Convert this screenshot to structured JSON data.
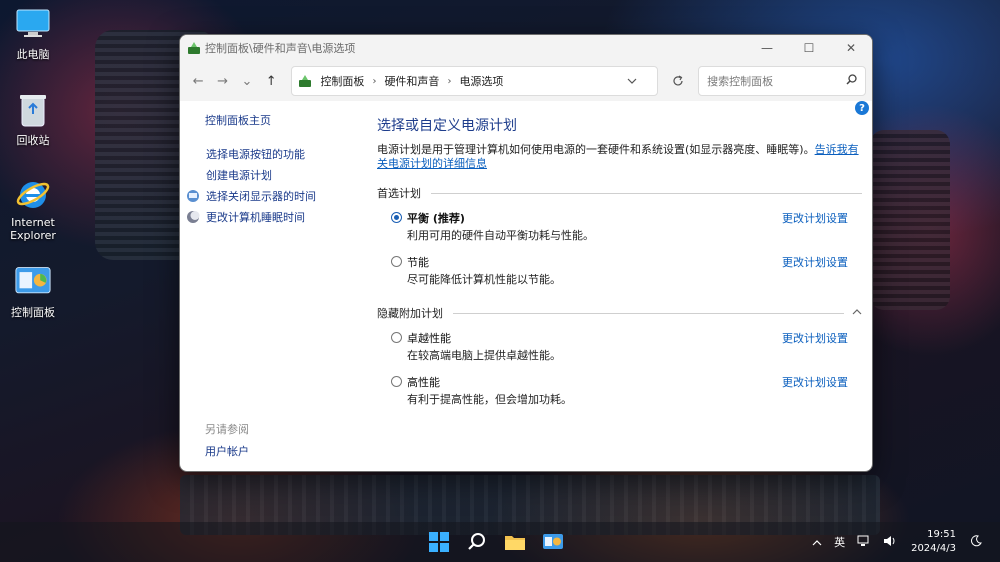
{
  "desktop": {
    "icons": [
      {
        "label": "此电脑"
      },
      {
        "label": "回收站"
      },
      {
        "label": "Internet Explorer"
      },
      {
        "label": "控制面板"
      }
    ]
  },
  "window": {
    "title": "控制面板\\硬件和声音\\电源选项",
    "controls": {
      "minimize": "—",
      "maximize": "☐",
      "close": "✕"
    },
    "nav": {
      "back": "←",
      "forward": "→",
      "recent": "⌄",
      "up": "↑"
    },
    "breadcrumb": [
      "控制面板",
      "硬件和声音",
      "电源选项"
    ],
    "breadcrumb_sep": "›",
    "search_placeholder": "搜索控制面板",
    "help": "?"
  },
  "left_pane": {
    "home": "控制面板主页",
    "links": [
      {
        "label": "选择电源按钮的功能",
        "icon": "none"
      },
      {
        "label": "创建电源计划",
        "icon": "none"
      },
      {
        "label": "选择关闭显示器的时间",
        "icon": "monitor-icon"
      },
      {
        "label": "更改计算机睡眠时间",
        "icon": "moon-icon"
      }
    ],
    "see_also": "另请参阅",
    "user_accounts": "用户帐户"
  },
  "main": {
    "heading": "选择或自定义电源计划",
    "description": "电源计划是用于管理计算机如何使用电源的一套硬件和系统设置(如显示器亮度、睡眠等)。",
    "description_link": "告诉我有关电源计划的详细信息",
    "preferred_group": "首选计划",
    "hidden_group": "隐藏附加计划",
    "change_label": "更改计划设置",
    "preferred_plans": [
      {
        "name": "平衡 (推荐)",
        "desc": "利用可用的硬件自动平衡功耗与性能。",
        "selected": true
      },
      {
        "name": "节能",
        "desc": "尽可能降低计算机性能以节能。",
        "selected": false
      }
    ],
    "hidden_plans": [
      {
        "name": "卓越性能",
        "desc": "在较高端电脑上提供卓越性能。",
        "selected": false
      },
      {
        "name": "高性能",
        "desc": "有利于提高性能，但会增加功耗。",
        "selected": false
      }
    ]
  },
  "taskbar": {
    "ime": "英",
    "time": "19:51",
    "date": "2024/4/3"
  },
  "colors": {
    "accent": "#1a5fb4",
    "link": "#0b5fbe",
    "heading": "#1e3d8c"
  }
}
